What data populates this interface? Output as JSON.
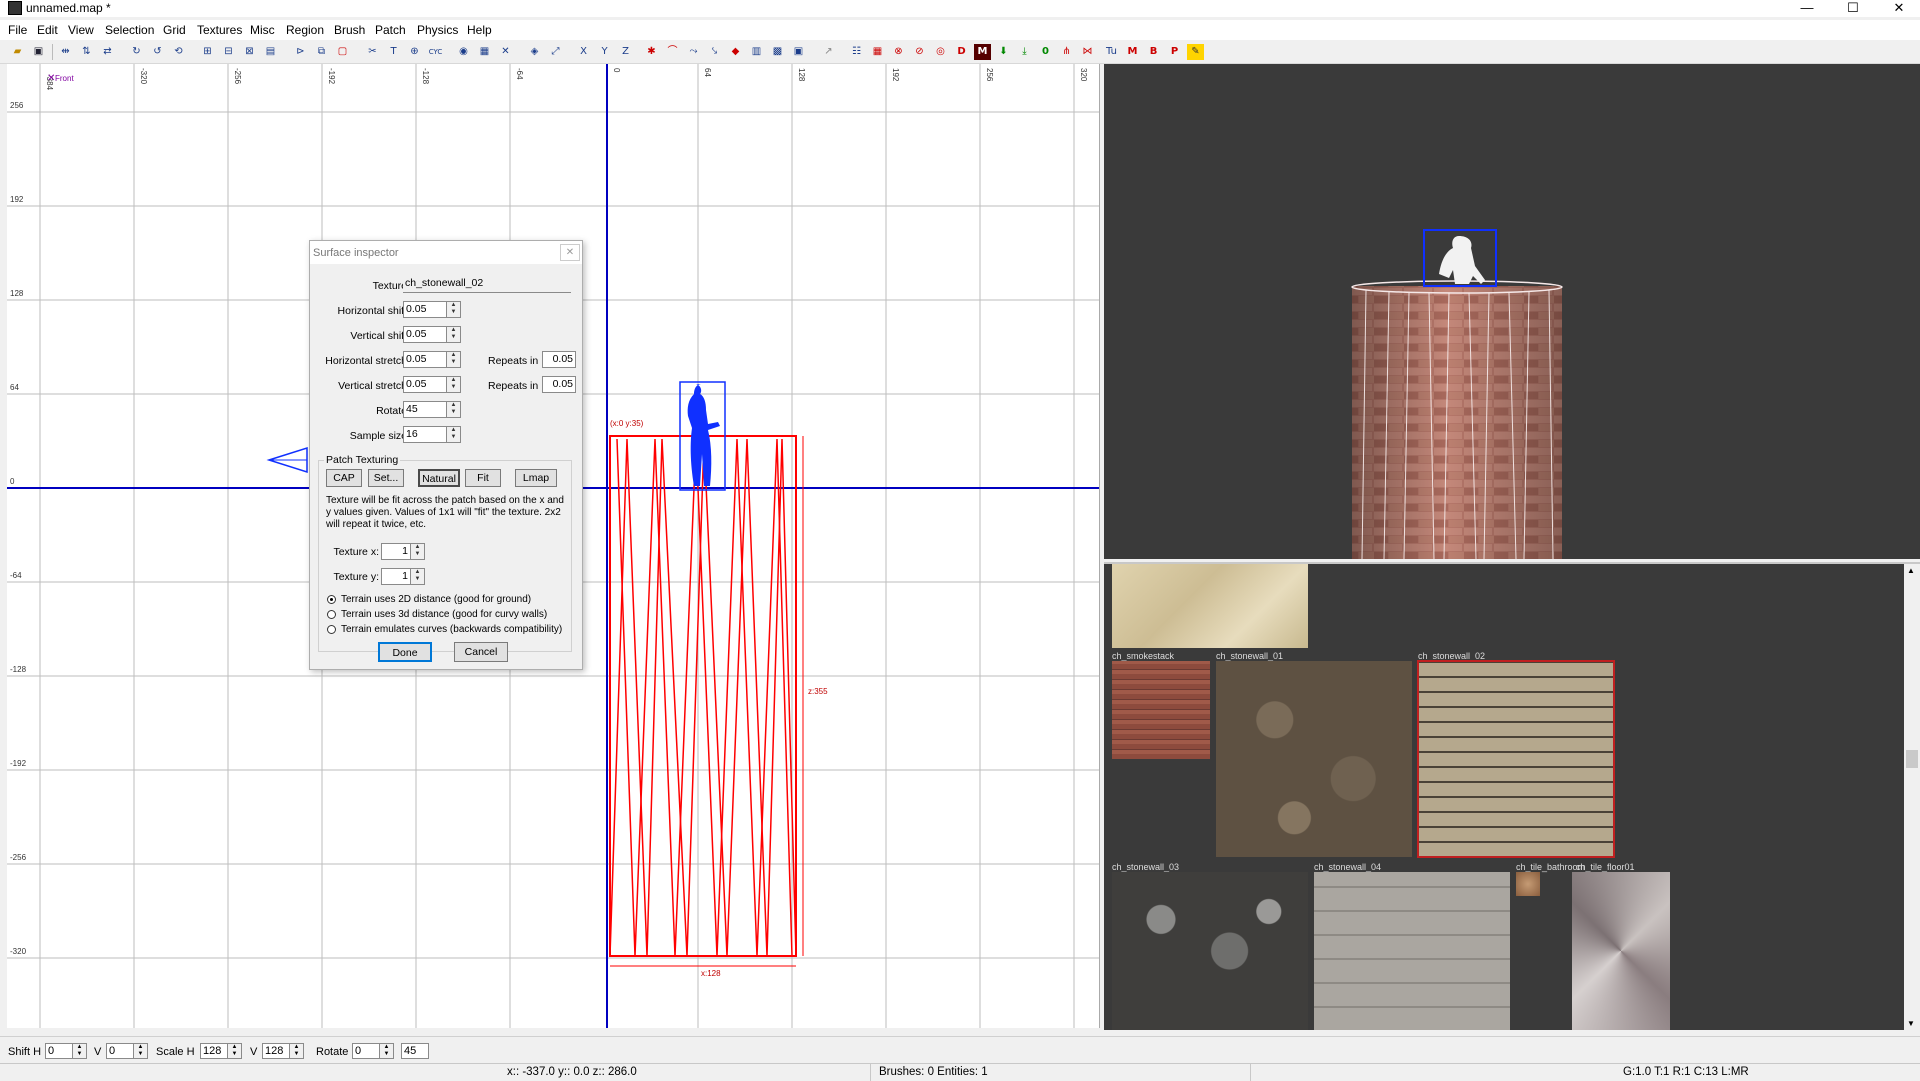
{
  "window": {
    "title": "unnamed.map *",
    "minimize": "—",
    "maximize": "☐",
    "close": "✕"
  },
  "menu": [
    "File",
    "Edit",
    "View",
    "Selection",
    "Grid",
    "Textures",
    "Misc",
    "Region",
    "Brush",
    "Patch",
    "Physics",
    "Help"
  ],
  "view2d": {
    "label": "Front",
    "x_ticks": [
      "-384",
      "-320",
      "-256",
      "-192",
      "-128",
      "-64",
      "0",
      "64",
      "128",
      "192",
      "256",
      "320"
    ],
    "y_ticks": [
      "256",
      "192",
      "128",
      "64",
      "0",
      "-64",
      "-128",
      "-192",
      "-256",
      "-320"
    ],
    "brush_coord": "(x:0  y:35)",
    "brush_height": "z:355",
    "brush_width": "x:128"
  },
  "dialog": {
    "title": "Surface inspector",
    "texture_label": "Texture",
    "texture_value": "ch_stonewall_02",
    "fields": [
      {
        "label": "Horizontal shift",
        "value": "0.05"
      },
      {
        "label": "Vertical shift",
        "value": "0.05"
      },
      {
        "label": "Horizontal stretch",
        "value": "0.05",
        "repeats_label": "Repeats in",
        "repeats": "0.05"
      },
      {
        "label": "Vertical stretch",
        "value": "0.05",
        "repeats_label": "Repeats in",
        "repeats": "0.05"
      },
      {
        "label": "Rotate",
        "value": "45"
      },
      {
        "label": "Sample size",
        "value": "16"
      }
    ],
    "group_label": "Patch Texturing",
    "patch_buttons": [
      "CAP",
      "Set...",
      "Natural",
      "Fit",
      "Lmap"
    ],
    "help_text": "Texture will be fit across the patch based on the x and y values given. Values of 1x1 will \"fit\" the texture. 2x2 will repeat it twice, etc.",
    "texture_x_label": "Texture x:",
    "texture_x": "1",
    "texture_y_label": "Texture y:",
    "texture_y": "1",
    "radios": [
      {
        "label": "Terrain uses 2D distance (good for ground)",
        "checked": true
      },
      {
        "label": "Terrain uses 3d distance (good for curvy walls)",
        "checked": false
      },
      {
        "label": "Terrain emulates curves (backwards compatibility)",
        "checked": false
      }
    ],
    "done": "Done",
    "cancel": "Cancel"
  },
  "textures": [
    {
      "name": "ch_smokestack"
    },
    {
      "name": "ch_stonewall_01"
    },
    {
      "name": "ch_stonewall_02"
    },
    {
      "name": "ch_stonewall_03"
    },
    {
      "name": "ch_stonewall_04"
    },
    {
      "name": "ch_tile_bathroom"
    },
    {
      "name": "ch_tile_floor01"
    }
  ],
  "statusbar": {
    "shift_h_label": "Shift H",
    "shift_h": "0",
    "v1_label": "V",
    "v1": "0",
    "scale_h_label": "Scale H",
    "scale_h": "128",
    "v2_label": "V",
    "v2": "128",
    "rotate_label": "Rotate",
    "rotate": "0",
    "rotate_step": "45",
    "coords": "x:: -337.0  y:: 0.0  z:: 286.0",
    "counts": "Brushes: 0 Entities: 1",
    "grid": "G:1.0 T:1 R:1 C:13 L:MR"
  },
  "colors": {
    "grid_line": "#c8c8c8",
    "axis": "#0000c0",
    "brush": "#ff0000",
    "entity": "#1030ff",
    "dialog_bg": "#f0f0f0",
    "dark_bg": "#3a3a3a"
  }
}
